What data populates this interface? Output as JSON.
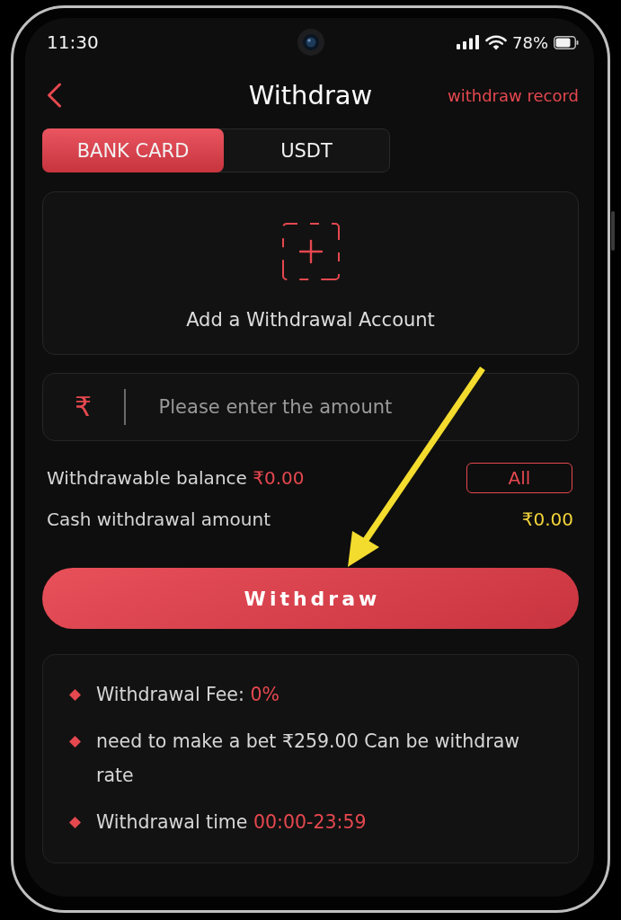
{
  "status_bar": {
    "time": "11:30",
    "battery": "78%"
  },
  "header": {
    "title": "Withdraw",
    "link": "withdraw record"
  },
  "tabs": [
    {
      "label": "BANK CARD",
      "selected": true
    },
    {
      "label": "USDT",
      "selected": false
    }
  ],
  "add_account": {
    "label": "Add a Withdrawal Account"
  },
  "amount_field": {
    "currency": "₹",
    "placeholder": "Please enter the amount"
  },
  "balance": {
    "label": "Withdrawable balance",
    "value": "₹0.00",
    "button": "All"
  },
  "cash_amount": {
    "label": "Cash withdrawal amount",
    "value": "₹0.00"
  },
  "withdraw_button": {
    "label": "Withdraw"
  },
  "notes": [
    {
      "text": "Withdrawal Fee:",
      "highlight": "0%"
    },
    {
      "text": "need to make a bet ₹259.00 Can be withdraw rate"
    },
    {
      "text": "Withdrawal time",
      "highlight": "00:00-23:59"
    }
  ]
}
